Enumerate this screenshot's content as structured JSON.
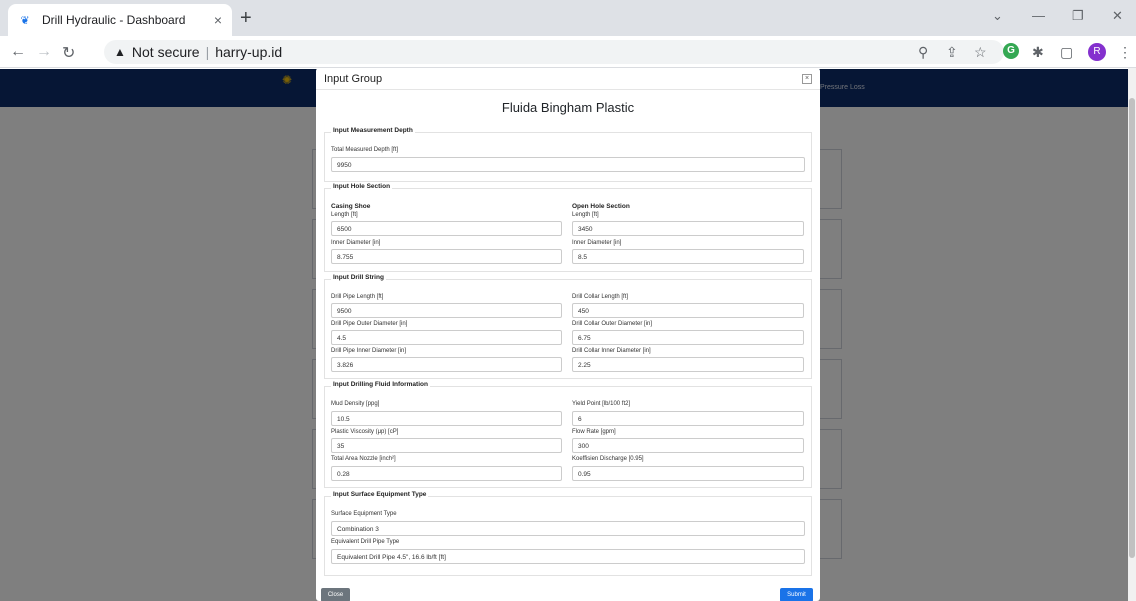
{
  "browser": {
    "tab_title": "Drill Hydraulic - Dashboard",
    "tab_close": "×",
    "new_tab": "+",
    "not_secure": "Not secure",
    "separator": "|",
    "url": "harry-up.id",
    "profile_initial": "R",
    "extension_letter": "G",
    "window_controls": {
      "minimize": "—",
      "restore": "❐",
      "close": "✕",
      "expand": "⌄"
    }
  },
  "page": {
    "nav_right": "Pressure Loss"
  },
  "modal": {
    "title": "Input Group",
    "form_title": "Fluida Bingham Plastic",
    "measurement": {
      "legend": "Input Measurement Depth",
      "total_label": "Total Measured Depth [ft]",
      "total_value": "9950"
    },
    "hole": {
      "legend": "Input Hole Section",
      "casing": "Casing Shoe",
      "open": "Open Hole Section",
      "casing_length_label": "Length [ft]",
      "casing_length_value": "6500",
      "open_length_label": "Length [ft]",
      "open_length_value": "3450",
      "casing_id_label": "Inner Diameter [in]",
      "casing_id_value": "8.755",
      "open_id_label": "Inner Diameter [in]",
      "open_id_value": "8.5"
    },
    "drill_string": {
      "legend": "Input Drill String",
      "dp_length_label": "Drill Pipe Length [ft]",
      "dp_length_value": "9500",
      "dc_length_label": "Drill Collar Length [ft]",
      "dc_length_value": "450",
      "dp_od_label": "Drill Pipe Outer Diameter [in]",
      "dp_od_value": "4.5",
      "dc_od_label": "Drill Collar Outer Diameter [in]",
      "dc_od_value": "6.75",
      "dp_id_label": "Drill Pipe Inner Diameter [in]",
      "dp_id_value": "3.826",
      "dc_id_label": "Drill Collar Inner Diameter [in]",
      "dc_id_value": "2.25"
    },
    "fluid": {
      "legend": "Input Drilling Fluid Information",
      "mud_label": "Mud Density [ppg]",
      "mud_value": "10.5",
      "yp_label": "Yield Point [lb/100 ft2]",
      "yp_value": "6",
      "pv_label": "Plastic Viscosity (μp) [cP]",
      "pv_value": "35",
      "flow_label": "Flow Rate [gpm]",
      "flow_value": "300",
      "tfa_label": "Total Area Nozzle [inch²]",
      "tfa_value": "0.28",
      "kd_label": "Koeffisien Discharge [0.95]",
      "kd_value": "0.95"
    },
    "surface": {
      "legend": "Input Surface Equipment Type",
      "type_label": "Surface Equipment Type",
      "type_value": "Combination 3",
      "edp_label": "Equivalent Drill Pipe Type",
      "edp_value": "Equivalent Drill Pipe 4.5\", 16.6 lb/ft [ft]"
    },
    "close_button": "Close",
    "submit_button": "Submit"
  },
  "colors": {
    "navbar": "#0d2d6b",
    "submit": "#1a73e8",
    "close": "#6c757d"
  }
}
